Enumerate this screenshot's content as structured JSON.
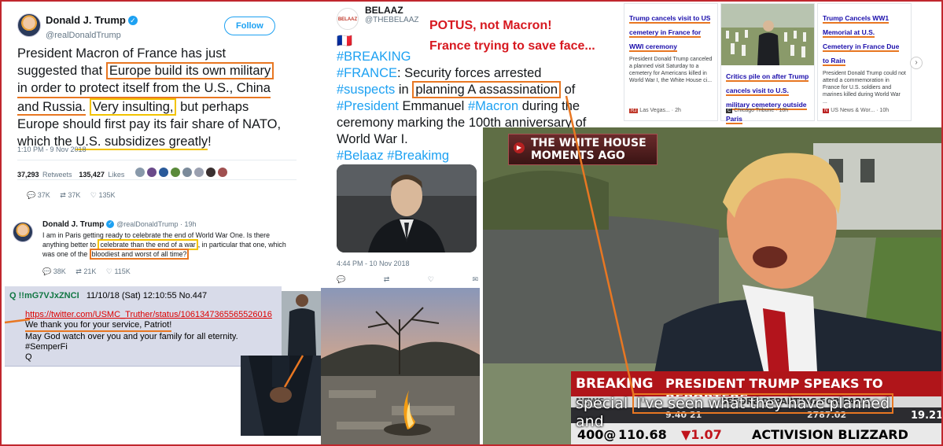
{
  "tweet1": {
    "name": "Donald J. Trump",
    "handle": "@realDonaldTrump",
    "follow": "Follow",
    "lines": [
      "President Macron of France has just",
      "suggested that",
      "Europe build its own military",
      "in order to protect itself from the U.S., China",
      "and Russia.",
      "Very insulting,",
      "but perhaps",
      "Europe should first pay its fair share of NATO,",
      "which the",
      "U.S. subsidizes greatly",
      "!"
    ],
    "time": "1:10 PM - 9 Nov 2018",
    "retweets_num": "37,293",
    "retweets_label": "Retweets",
    "likes_num": "135,427",
    "likes_label": "Likes",
    "reply_count": "37K",
    "rt_count": "37K",
    "like_count": "135K"
  },
  "tweet2": {
    "name": "Donald J. Trump",
    "handle": "@realDonaldTrump · 19h",
    "line1": "I am in Paris getting ready to celebrate the end of World War One. Is there",
    "line2a": "anything better to",
    "line2b": "celebrate than the end of a war",
    "line2c": ", in particular that one, which",
    "line3a": "was one of the",
    "line3b": "bloodiest and worst of all time?",
    "reply_count": "38K",
    "rt_count": "21K",
    "like_count": "115K"
  },
  "belaaz": {
    "logo": "BELAAZ",
    "name": "BELAAZ",
    "handle": "@THEBELAAZ",
    "flag": "🇫🇷",
    "hashtag1": "#BREAKING",
    "hashtag2": "#FRANCE",
    "line2": ": Security forces arrested",
    "hashtag3": "#suspects",
    "line3a": " in ",
    "line3b": "planning A assassination",
    "line3c": " of",
    "hashtag4": "#President",
    "line4a": " Emmanuel ",
    "hashtag5": "#Macron",
    "line4b": " during the",
    "line5": "ceremony marking the 100th anniversary of",
    "line6": "World War I.",
    "hashtag6": "#Belaaz #Breakimg",
    "time": "4:44 PM - 10 Nov 2018"
  },
  "annotation": {
    "line1": "POTUS, not Macron!",
    "line2": "France trying to save face..."
  },
  "news": [
    {
      "title": "Trump cancels visit to US cemetery in France for WWI ceremony",
      "body": "President Donald Trump canceled a planned visit Saturday to a cemetery for Americans killed in World War I, the White House ci...",
      "source": "Las Vegas...",
      "age": "2h",
      "badge": "RJ"
    },
    {
      "title": "Critics pile on after Trump cancels visit to U.S. military cemetery outside Paris",
      "source": "Chicago Tribune",
      "age": "10h"
    },
    {
      "title": "Trump Cancels WW1 Memorial at U.S. Cemetery in France Due to Rain",
      "body": "President Donald Trump could not attend a commemoration in France for U.S. soldiers and marines killed during World War ...",
      "source": "US News & Wor...",
      "age": "10h"
    }
  ],
  "qpost": {
    "id": "Q !!mG7VJxZNCI",
    "datetime": "11/10/18 (Sat) 12:10:55",
    "number": "No.447",
    "link": "https://twitter.com/USMC_Truther/status/1061347365565526016",
    "line1": "We thank you for your service, Patriot!",
    "line2": "May God watch over you and your family for all eternity.",
    "line3": "#SemperFi",
    "line4": "Q"
  },
  "video": {
    "banner1": "THE WHITE HOUSE",
    "banner2": "MOMENTS AGO",
    "breaking": "BREAKING",
    "news": "NEWS",
    "headline": "PRESIDENT TRUMP SPEAKS TO REPORTERS",
    "subline": "BEFORE DEPARTING FOR PARIS",
    "caption_a": "special",
    "caption_b": "I've seen what they have planned",
    "caption_c": "and",
    "ticker1": "110.68",
    "ticker2": "▼1.07",
    "ticker3": "ACTIVISION BLIZZARD",
    "ticker_left": "400@",
    "price1": "19.21",
    "price2": "2787.02",
    "price3": "9.40 21"
  },
  "colors": {
    "highlight_orange": "#e87722",
    "highlight_yellow": "#f2c300",
    "annotation_red": "#d71920",
    "twitter_blue": "#1da1f2",
    "frame_red": "#c0272d"
  }
}
